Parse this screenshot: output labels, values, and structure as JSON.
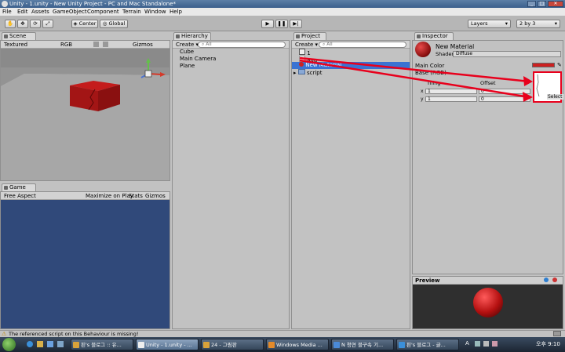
{
  "window": {
    "title": "Unity - 1.unity - New Unity Project - PC and Mac Standalone*"
  },
  "menu": [
    "File",
    "Edit",
    "Assets",
    "GameObject",
    "Component",
    "Terrain",
    "Window",
    "Help"
  ],
  "toolbar": {
    "pivot_label": "Center",
    "space_label": "Global",
    "layers_label": "Layers",
    "layout_label": "2 by 3"
  },
  "scene": {
    "tab": "Scene",
    "shading": "Textured",
    "render_mode": "RGB",
    "gizmos_label": "Gizmos",
    "search_placeholder": "All"
  },
  "game": {
    "tab": "Game",
    "aspect": "Free Aspect",
    "maximize_label": "Maximize on Play",
    "stats_label": "Stats",
    "gizmos_label": "Gizmos"
  },
  "hierarchy": {
    "tab": "Hierarchy",
    "create_label": "Create",
    "search_placeholder": "All",
    "items": [
      "Cube",
      "Main Camera",
      "Plane"
    ]
  },
  "project": {
    "tab": "Project",
    "create_label": "Create",
    "search_placeholder": "All",
    "items": [
      {
        "label": "1"
      },
      {
        "label": "aaa"
      },
      {
        "label": "New Material"
      },
      {
        "label": "script"
      }
    ]
  },
  "inspector": {
    "tab": "Inspector",
    "material_name": "New Material",
    "shader_label": "Shader",
    "shader_value": "Diffuse",
    "main_color_label": "Main Color",
    "base_label": "Base (RGB)",
    "tiling_label": "Tiling",
    "offset_label": "Offset",
    "x_label": "x",
    "y_label": "y",
    "tiling_x": "1",
    "tiling_y": "1",
    "offset_x": "0",
    "offset_y": "0",
    "select_label": "Select",
    "main_color": "#cc1f1f"
  },
  "preview": {
    "label": "Preview"
  },
  "status": {
    "message": "The referenced script on this Behaviour is missing!"
  },
  "taskbar": {
    "items": [
      "핀's 블로그 :: 유...",
      "Unity - 1.unity - ...",
      "24 - 그림판",
      "Windows Media ...",
      "N 청연 블구속 기...",
      "핀's 블로그 - 글..."
    ],
    "language": "A",
    "clock": "오후 9:10"
  },
  "colors": {
    "accent": "#3a73d3",
    "annotation": "#e8001c"
  }
}
